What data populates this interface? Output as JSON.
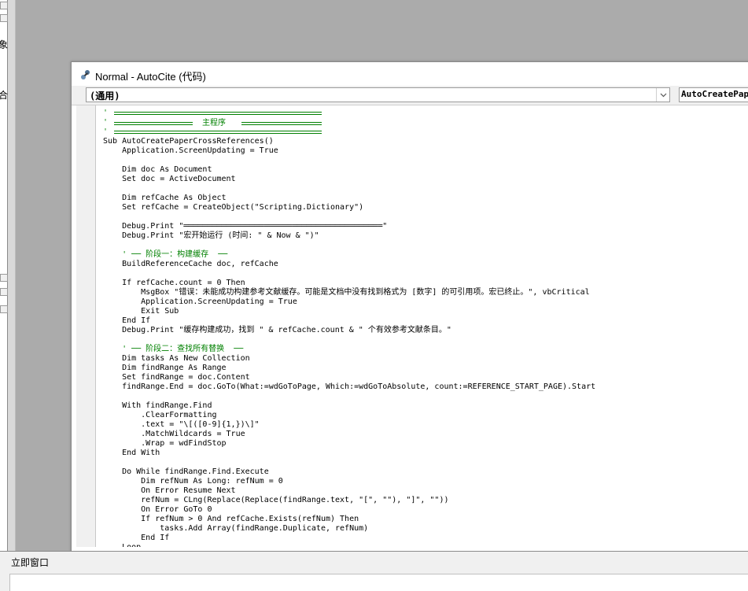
{
  "left_fragments": [
    "象",
    "合"
  ],
  "code_window": {
    "title": "Normal - AutoCite (代码)",
    "object_combo": "(通用)",
    "procedure_combo": "AutoCreatePaperCrossReferences"
  },
  "code": {
    "header_title": "主程序",
    "lines": [
      "'",
      "'",
      "'",
      "Sub AutoCreatePaperCrossReferences()",
      "    Application.ScreenUpdating = True",
      "",
      "    Dim doc As Document",
      "    Set doc = ActiveDocument",
      "",
      "    Dim refCache As Object",
      "    Set refCache = CreateObject(\"Scripting.Dictionary\")",
      "",
      "    Debug.Print \"══════════════════════════════════════════\"",
      "    Debug.Print \"宏开始运行 (时间: \" & Now & \")\"",
      "",
      "    ' ── 阶段一：构建缓存  ──",
      "    BuildReferenceCache doc, refCache",
      "",
      "    If refCache.count = 0 Then",
      "        MsgBox \"错误：未能成功构建参考文献缓存。可能是文档中没有找到格式为 [数字] 的可引用项。宏已终止。\", vbCritical",
      "        Application.ScreenUpdating = True",
      "        Exit Sub",
      "    End If",
      "    Debug.Print \"缓存构建成功，找到 \" & refCache.count & \" 个有效参考文献条目。\"",
      "",
      "    ' ── 阶段二：查找所有替换  ──",
      "    Dim tasks As New Collection",
      "    Dim findRange As Range",
      "    Set findRange = doc.Content",
      "    findRange.End = doc.GoTo(What:=wdGoToPage, Which:=wdGoToAbsolute, count:=REFERENCE_START_PAGE).Start",
      "",
      "    With findRange.Find",
      "        .ClearFormatting",
      "        .text = \"\\[([0-9]{1,})\\]\"",
      "        .MatchWildcards = True",
      "        .Wrap = wdFindStop",
      "    End With",
      "",
      "    Do While findRange.Find.Execute",
      "        Dim refNum As Long: refNum = 0",
      "        On Error Resume Next",
      "        refNum = CLng(Replace(Replace(findRange.text, \"[\", \"\"), \"]\", \"\"))",
      "        On Error GoTo 0",
      "        If refNum > 0 And refCache.Exists(refNum) Then",
      "            tasks.Add Array(findRange.Duplicate, refNum)",
      "        End If",
      "    Loop"
    ]
  },
  "immediate_window": {
    "label": "立即窗口"
  }
}
